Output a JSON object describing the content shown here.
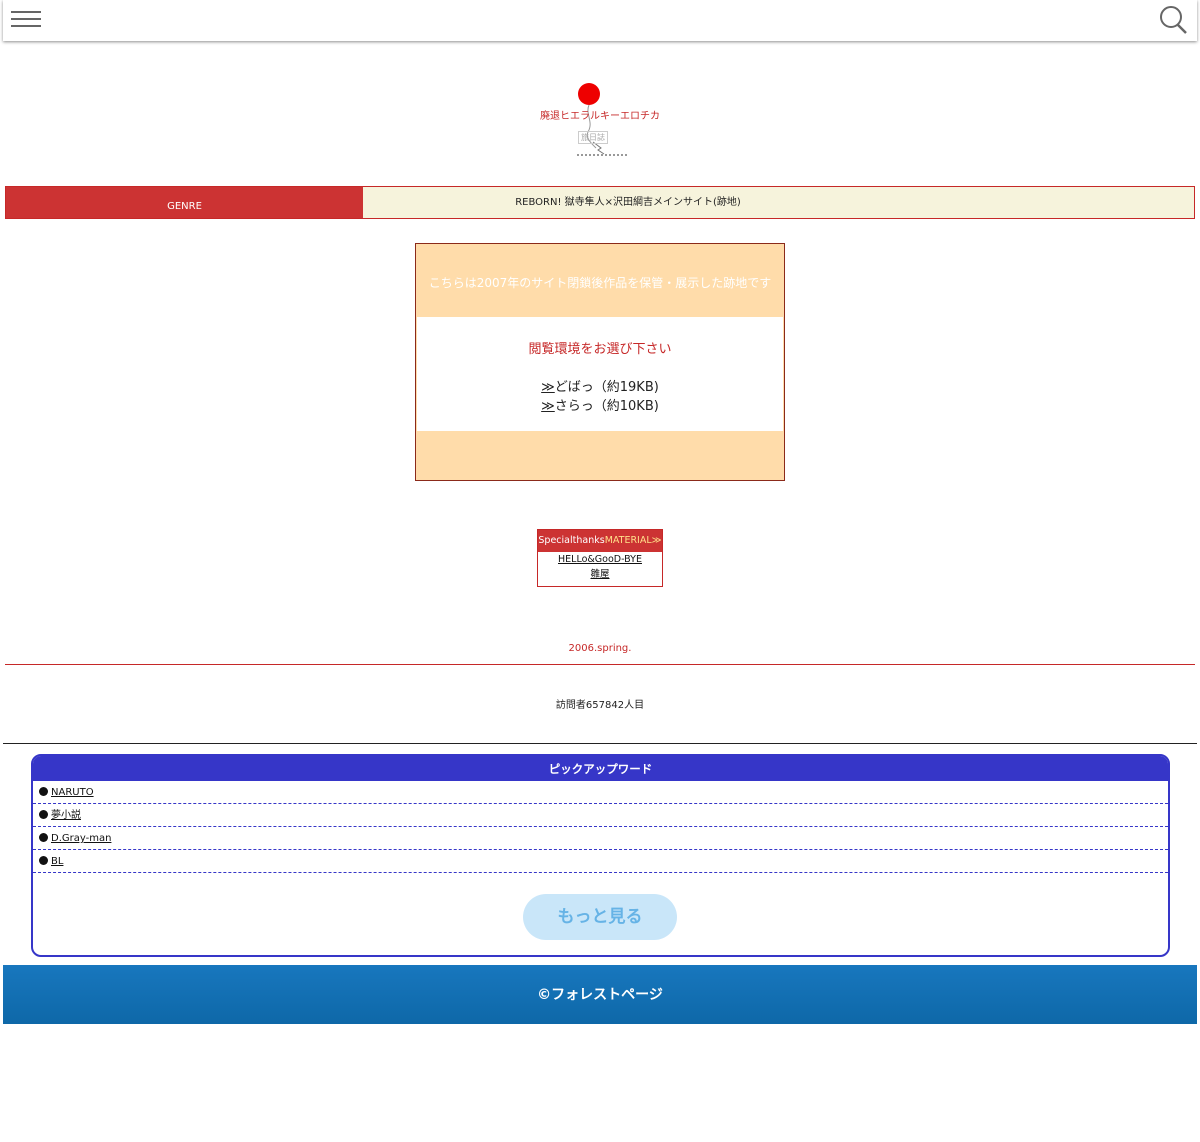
{
  "topbar": {
    "menu_icon": "hamburger-icon",
    "search_icon": "search-icon"
  },
  "logo": {
    "title": "廃退ヒエラルキーエロチカ",
    "sub": "旅日誌"
  },
  "genre": {
    "label": "GENRE",
    "value": "REBORN! 獄寺隼人×沢田綱吉メインサイト(跡地)"
  },
  "notice": {
    "heading": "こちらは2007年のサイト閉鎖後作品を保管・展示した跡地です",
    "prompt": "閲覧環境をお選び下さい",
    "links": [
      {
        "arrow": "≫",
        "text": "どばっ（約19KB)"
      },
      {
        "arrow": "≫",
        "text": "さらっ（約10KB)"
      }
    ]
  },
  "thanks": {
    "head_prefix": "Specialthanks",
    "head_highlight": "MATERIAL≫",
    "links": [
      "HELLo&GooD-BYE",
      "雛屋"
    ]
  },
  "season": "2006.spring.",
  "visitor": "訪問者657842人目",
  "pickup": {
    "title": "ピックアップワード",
    "items": [
      "NARUTO",
      "夢小説",
      "D.Gray-man",
      "BL"
    ],
    "more": "もっと見る"
  },
  "footer": "©フォレストページ",
  "colors": {
    "accent_red": "#cc3333",
    "pickup_blue": "#3636c8",
    "footer_blue": "#1877be",
    "notice_bg": "#ffdcaa"
  }
}
